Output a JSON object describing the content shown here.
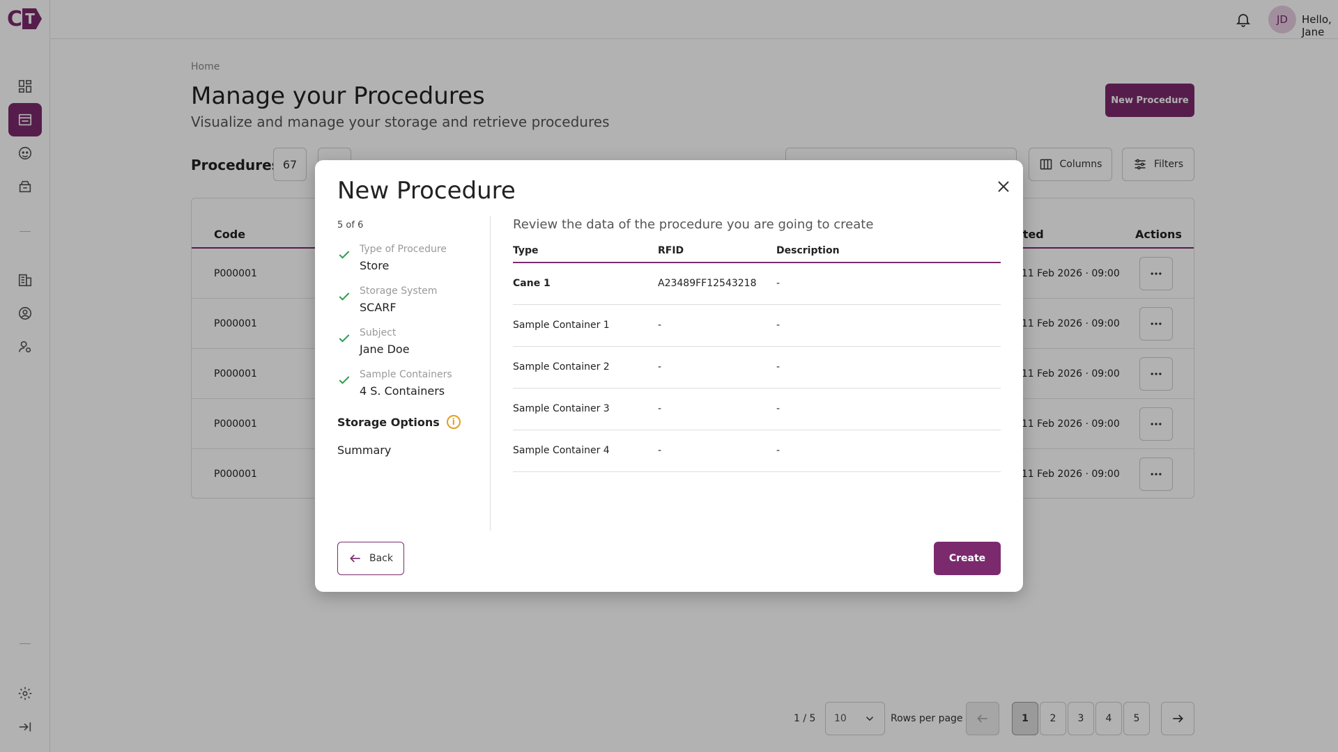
{
  "app": {
    "logo_c": "C",
    "logo_t": "T"
  },
  "topbar": {
    "avatar_initials": "JD",
    "greeting": "Hello, Jane"
  },
  "page": {
    "breadcrumb": "Home",
    "title": "Manage your Procedures",
    "subtitle": "Visualize and manage your storage and retrieve procedures",
    "new_button": "New Procedure"
  },
  "procedures": {
    "label": "Procedures",
    "count": "67",
    "second_count": "",
    "columns_label": "Columns",
    "filters_label": "Filters",
    "headers": {
      "code": "Code",
      "created": "ated",
      "actions": "Actions"
    },
    "rows": [
      {
        "code": "P000001",
        "date": ", 11 Feb 2026 · 09:00"
      },
      {
        "code": "P000001",
        "date": ", 11 Feb 2026 · 09:00"
      },
      {
        "code": "P000001",
        "date": ", 11 Feb 2026 · 09:00"
      },
      {
        "code": "P000001",
        "date": ", 11 Feb 2026 · 09:00"
      },
      {
        "code": "P000001",
        "date": ", 11 Feb 2026 · 09:00"
      }
    ]
  },
  "pagination": {
    "info": "1 / 5",
    "rows_value": "10",
    "rows_label": "Rows per page",
    "pages": [
      "1",
      "2",
      "3",
      "4",
      "5"
    ],
    "current": "1"
  },
  "modal": {
    "title": "New Procedure",
    "step_count": "5 of 6",
    "steps": [
      {
        "label": "Type of Procedure",
        "value": "Store"
      },
      {
        "label": "Storage System",
        "value": "SCARF"
      },
      {
        "label": "Subject",
        "value": "Jane Doe"
      },
      {
        "label": "Sample Containers",
        "value": "4 S. Containers"
      }
    ],
    "current_step": "Storage Options",
    "current_step_icon": "i",
    "next_step": "Summary",
    "review_title": "Review the data of the procedure you are going to create",
    "table_headers": {
      "type": "Type",
      "rfid": "RFID",
      "description": "Description"
    },
    "table_rows": [
      {
        "type": "Cane 1",
        "rfid": "A23489FF12543218",
        "description": "-"
      },
      {
        "type": "Sample Container 1",
        "rfid": "-",
        "description": "-"
      },
      {
        "type": "Sample Container 2",
        "rfid": "-",
        "description": "-"
      },
      {
        "type": "Sample Container 3",
        "rfid": "-",
        "description": "-"
      },
      {
        "type": "Sample Container 4",
        "rfid": "-",
        "description": "-"
      }
    ],
    "back_label": "Back",
    "create_label": "Create"
  },
  "colors": {
    "accent": "#7b2a6e",
    "success": "#2e9e4f",
    "warning": "#e0a020"
  }
}
